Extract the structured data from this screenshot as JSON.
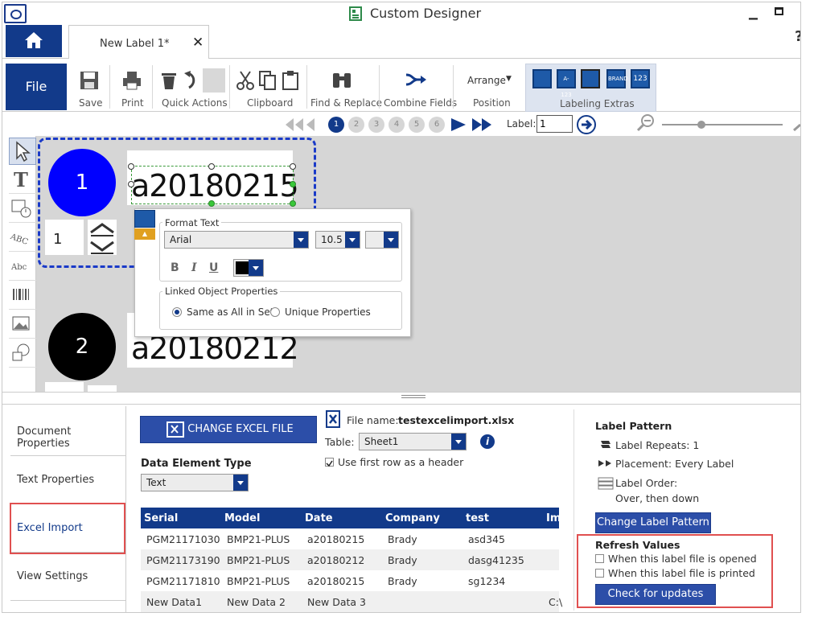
{
  "window": {
    "title": "Custom Designer"
  },
  "tab": {
    "label": "New Label 1*",
    "close": "✕"
  },
  "help_glyph": "?",
  "ribbon": {
    "file": "File",
    "groups": [
      {
        "label": "Save"
      },
      {
        "label": "Print"
      },
      {
        "label": "Quick Actions"
      },
      {
        "label": "Clipboard"
      },
      {
        "label": "Find & Replace"
      },
      {
        "label": "Combine Fields"
      },
      {
        "label": "Position"
      },
      {
        "label": "Labeling Extras"
      }
    ],
    "arrange": "Arrange",
    "extras_buttons": [
      "",
      "A-123",
      "",
      "BRAND",
      "123"
    ]
  },
  "nav": {
    "pages": [
      "1",
      "2",
      "3",
      "4",
      "5",
      "6"
    ],
    "active_page": "1",
    "label_caption": "Label:",
    "label_value": "1"
  },
  "canvas": {
    "labels": [
      {
        "number": "1",
        "text": "a20180215",
        "color": "#0000ff",
        "counter": "1"
      },
      {
        "number": "2",
        "text": "a20180212",
        "color": "#000000"
      }
    ]
  },
  "format_popup": {
    "format_text": "Format Text",
    "font": "Arial",
    "size": "10.5",
    "bold": "B",
    "italic": "I",
    "underline": "U",
    "text_color": "#000000",
    "linked_title": "Linked Object Properties",
    "radio_same": "Same as All in Set",
    "radio_unique": "Unique Properties"
  },
  "side_nav": {
    "items": [
      "Document Properties",
      "Text Properties",
      "Excel Import",
      "View Settings"
    ]
  },
  "excel": {
    "change_button": "CHANGE EXCEL FILE",
    "file_name_label": "File name:",
    "file_name": "testexcelimport.xlsx",
    "table_label": "Table:",
    "table_value": "Sheet1",
    "first_row_header": "Use first row as a header",
    "data_type_label": "Data Element Type",
    "data_type_value": "Text",
    "columns": [
      "Serial",
      "Model",
      "Date",
      "Company",
      "test",
      "Im"
    ],
    "rows": [
      [
        "PGM21171030",
        "BMP21-PLUS",
        "a20180215",
        "Brady",
        "asd345",
        ""
      ],
      [
        "PGM21173190",
        "BMP21-PLUS",
        "a20180212",
        "Brady",
        "dasg41235",
        ""
      ],
      [
        "PGM21171810",
        "BMP21-PLUS",
        "a20180215",
        "Brady",
        "sg1234",
        ""
      ],
      [
        "New Data1",
        "New Data 2",
        "New Data 3",
        "",
        "",
        "C:\\"
      ]
    ]
  },
  "pattern": {
    "title": "Label Pattern",
    "repeats": "Label Repeats: 1",
    "placement": "Placement: Every Label",
    "order_label": "Label Order:",
    "order_value": "Over, then down",
    "change_button": "Change Label Pattern"
  },
  "refresh": {
    "title": "Refresh Values",
    "opened": "When this label file is opened",
    "printed": "When this label file is printed",
    "check_button": "Check for updates"
  },
  "colors": {
    "brand": "#123a8a",
    "highlight": "#e05050"
  }
}
